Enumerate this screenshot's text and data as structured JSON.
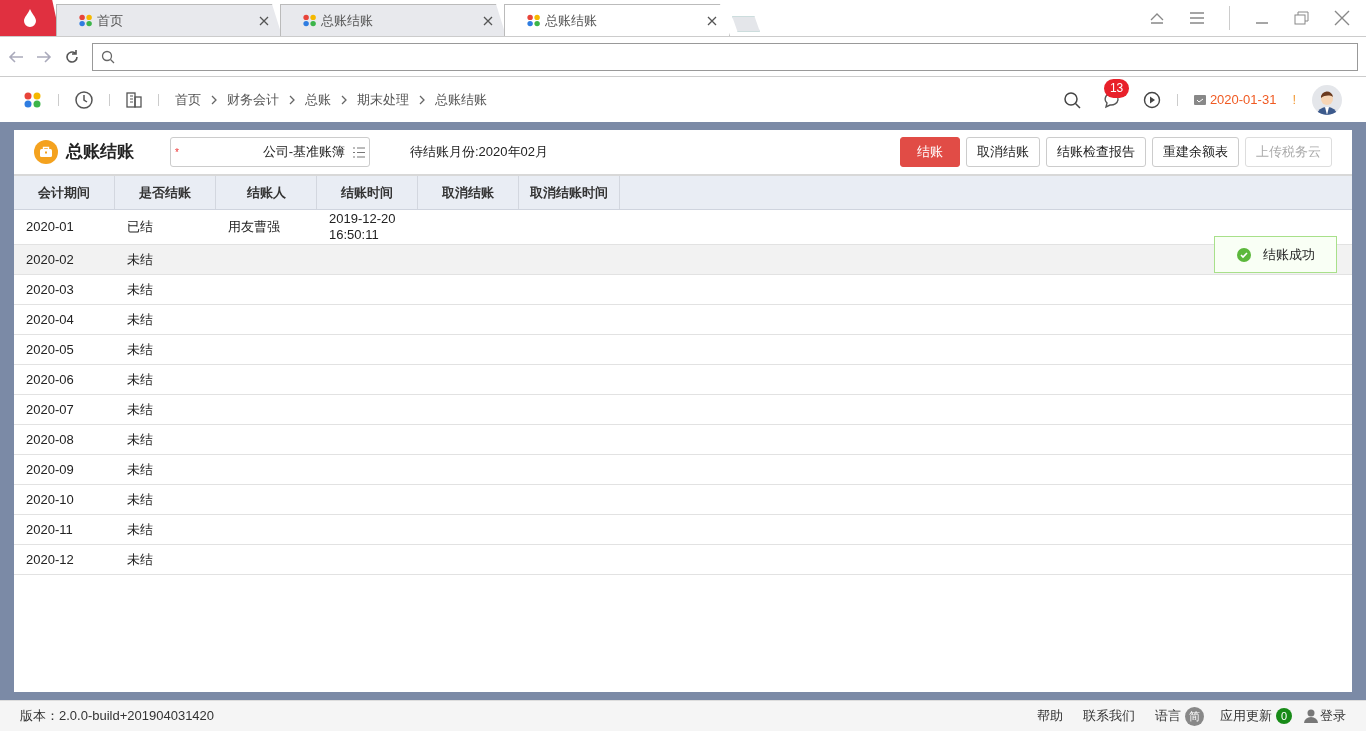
{
  "browser_tabs": [
    {
      "label": "首页",
      "selected": false
    },
    {
      "label": "总账结账",
      "selected": false
    },
    {
      "label": "总账结账",
      "selected": true
    }
  ],
  "breadcrumb": [
    "首页",
    "财务会计",
    "总账",
    "期末处理",
    "总账结账"
  ],
  "header": {
    "message_count": "13",
    "date": "2020-01-31",
    "alert": "!"
  },
  "page": {
    "title": "总账结账",
    "ledger_field": {
      "required_mark": "*",
      "value": "公司-基准账簿"
    },
    "pending_month": "待结账月份:2020年02月"
  },
  "buttons": [
    {
      "label": "结账",
      "kind": "primary",
      "disabled": false
    },
    {
      "label": "取消结账",
      "kind": "default",
      "disabled": false
    },
    {
      "label": "结账检查报告",
      "kind": "default",
      "disabled": false
    },
    {
      "label": "重建余额表",
      "kind": "default",
      "disabled": false
    },
    {
      "label": "上传税务云",
      "kind": "default",
      "disabled": true
    }
  ],
  "table": {
    "columns": [
      "会计期间",
      "是否结账",
      "结账人",
      "结账时间",
      "取消结账",
      "取消结账时间"
    ],
    "rows": [
      {
        "selected": false,
        "cells": [
          "2020-01",
          "已结",
          "用友曹强",
          "2019-12-20 16:50:11",
          "",
          ""
        ]
      },
      {
        "selected": true,
        "cells": [
          "2020-02",
          "未结",
          "",
          "",
          "",
          ""
        ]
      },
      {
        "selected": false,
        "cells": [
          "2020-03",
          "未结",
          "",
          "",
          "",
          ""
        ]
      },
      {
        "selected": false,
        "cells": [
          "2020-04",
          "未结",
          "",
          "",
          "",
          ""
        ]
      },
      {
        "selected": false,
        "cells": [
          "2020-05",
          "未结",
          "",
          "",
          "",
          ""
        ]
      },
      {
        "selected": false,
        "cells": [
          "2020-06",
          "未结",
          "",
          "",
          "",
          ""
        ]
      },
      {
        "selected": false,
        "cells": [
          "2020-07",
          "未结",
          "",
          "",
          "",
          ""
        ]
      },
      {
        "selected": false,
        "cells": [
          "2020-08",
          "未结",
          "",
          "",
          "",
          ""
        ]
      },
      {
        "selected": false,
        "cells": [
          "2020-09",
          "未结",
          "",
          "",
          "",
          ""
        ]
      },
      {
        "selected": false,
        "cells": [
          "2020-10",
          "未结",
          "",
          "",
          "",
          ""
        ]
      },
      {
        "selected": false,
        "cells": [
          "2020-11",
          "未结",
          "",
          "",
          "",
          ""
        ]
      },
      {
        "selected": false,
        "cells": [
          "2020-12",
          "未结",
          "",
          "",
          "",
          ""
        ]
      }
    ]
  },
  "toast": {
    "message": "结账成功"
  },
  "status_bar": {
    "version": "版本：2.0.0-build+201904031420",
    "help": "帮助",
    "contact": "联系我们",
    "language_label": "语言",
    "language": "简",
    "updates_label": "应用更新",
    "updates": "0",
    "login": "登录"
  }
}
